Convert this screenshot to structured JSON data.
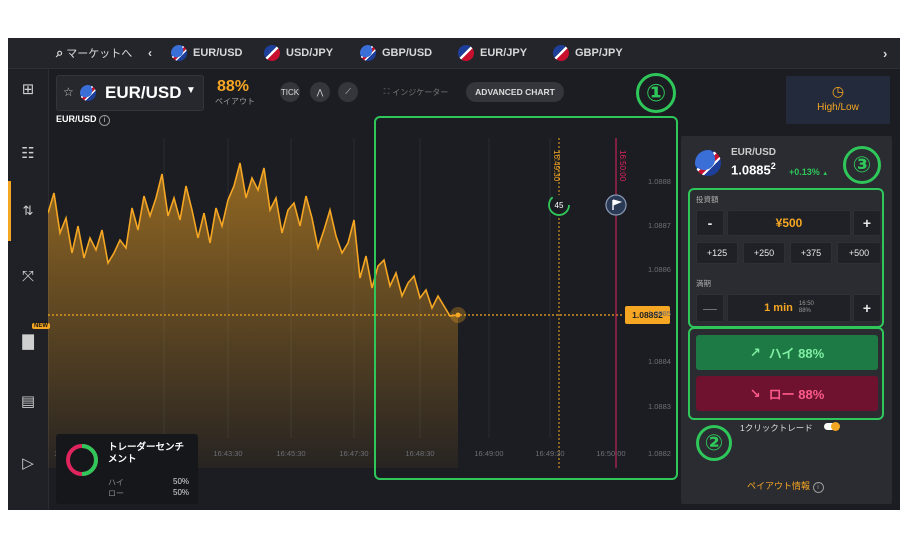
{
  "tabs": {
    "search_label": "マーケットへ",
    "items": [
      {
        "label": "EUR/USD",
        "flag": "eur-usd-flag-icon"
      },
      {
        "label": "USD/JPY",
        "flag": "usd-jpy-flag-icon"
      },
      {
        "label": "GBP/USD",
        "flag": "gbp-usd-flag-icon"
      },
      {
        "label": "EUR/JPY",
        "flag": "eur-jpy-flag-icon"
      },
      {
        "label": "GBP/JPY",
        "flag": "gbp-jpy-flag-icon"
      }
    ]
  },
  "sidebar": {
    "icons": [
      "grid-icon",
      "list-icon",
      "trade-icon",
      "swap-icon",
      "ranking-icon",
      "news-icon",
      "video-icon"
    ],
    "new_badge": "NEW"
  },
  "header": {
    "asset": "EUR/USD",
    "payout_value": "88%",
    "payout_label": "ペイアウト",
    "tick": "TICK",
    "indicator": "インジケーター",
    "advanced_chart": "ADVANCED CHART",
    "subtitle": "EUR/USD"
  },
  "chart": {
    "current_price": "1.08852",
    "price_ticks": [
      "1.0888",
      "1.0887",
      "1.0886",
      "1.0885",
      "1.0884",
      "1.0883",
      "1.0882"
    ],
    "time_ticks": [
      "16:43:30",
      "16:45:30",
      "16:47:30",
      "16:48:30",
      "16:49:00",
      "16:49:30",
      "16:50:00"
    ],
    "first_tick_partial": "16",
    "vline_orange": "16:49:30",
    "vline_red": "16:50:00",
    "countdown": "45",
    "line_color": "#f5a623"
  },
  "sentiment": {
    "title": "トレーダーセンチメント",
    "high_label": "ハイ",
    "high_value": "50%",
    "low_label": "ロー",
    "low_value": "50%"
  },
  "right_panel": {
    "highlow_label": "High/Low",
    "asset": "EUR/USD",
    "price_main": "1.0885",
    "price_sup": "2",
    "change": "+0.13%",
    "investment_label": "投資額",
    "minus": "-",
    "plus": "+",
    "amount": "¥500",
    "quick_amounts": [
      "+125",
      "+250",
      "+375",
      "+500"
    ],
    "expiry_label": "満期",
    "expiry_value": "1 min",
    "expiry_time": "16:50",
    "expiry_pct": "88%",
    "high_button": "ハイ 88%",
    "low_button": "ロー 88%",
    "one_click": "1クリックトレード",
    "payout_info": "ペイアウト情報",
    "accent": "#f5a623",
    "up_color": "#2fc65a",
    "down_color": "#e0245e"
  },
  "annotations": {
    "n1": "①",
    "n2": "②",
    "n3": "③"
  }
}
